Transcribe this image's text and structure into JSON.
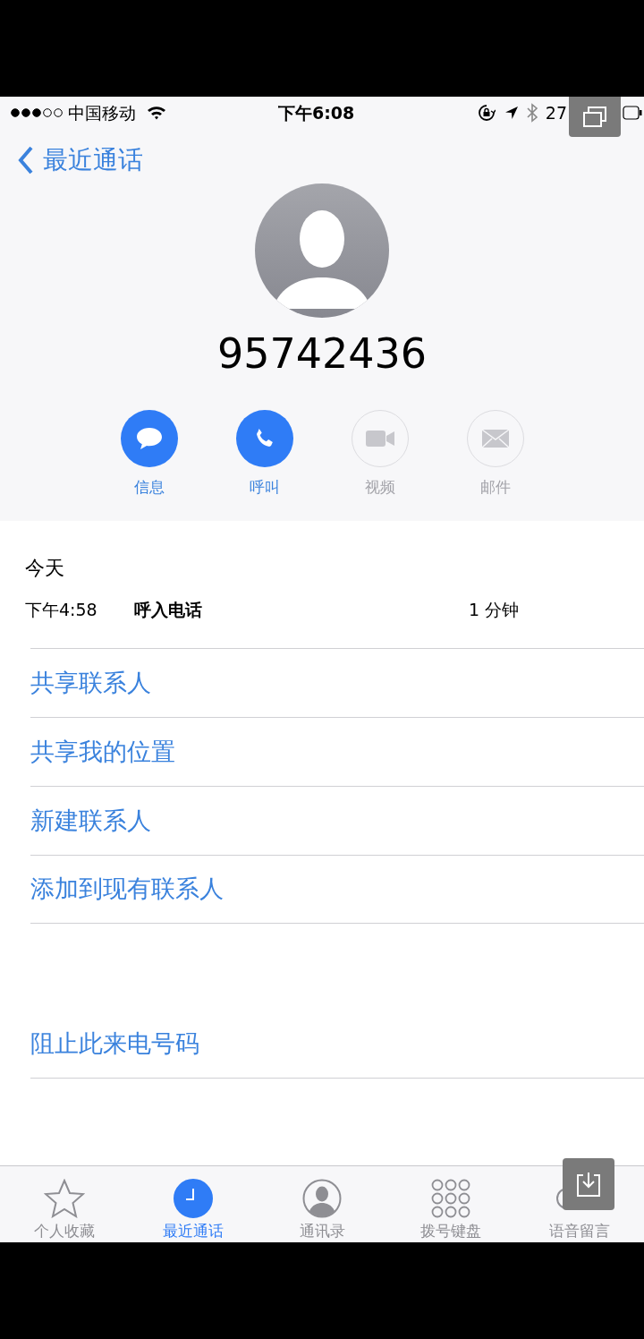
{
  "status_bar": {
    "carrier": "中国移动",
    "time": "下午6:08",
    "battery": "27"
  },
  "nav": {
    "back": "最近通话"
  },
  "contact": {
    "number": "95742436"
  },
  "actions": [
    {
      "label": "信息",
      "kind": "message",
      "enabled": true
    },
    {
      "label": "呼叫",
      "kind": "call",
      "enabled": true
    },
    {
      "label": "视频",
      "kind": "video",
      "enabled": false
    },
    {
      "label": "邮件",
      "kind": "mail",
      "enabled": false
    }
  ],
  "history": {
    "date": "今天",
    "time": "下午4:58",
    "type": "呼入电话",
    "duration": "1 分钟"
  },
  "options": [
    "共享联系人",
    "共享我的位置",
    "新建联系人",
    "添加到现有联系人"
  ],
  "block": "阻止此来电号码",
  "tabs": [
    {
      "label": "个人收藏",
      "kind": "favorites",
      "selected": false
    },
    {
      "label": "最近通话",
      "kind": "recents",
      "selected": true
    },
    {
      "label": "通讯录",
      "kind": "contacts",
      "selected": false
    },
    {
      "label": "拨号键盘",
      "kind": "keypad",
      "selected": false
    },
    {
      "label": "语音留言",
      "kind": "voicemail",
      "selected": false
    }
  ]
}
